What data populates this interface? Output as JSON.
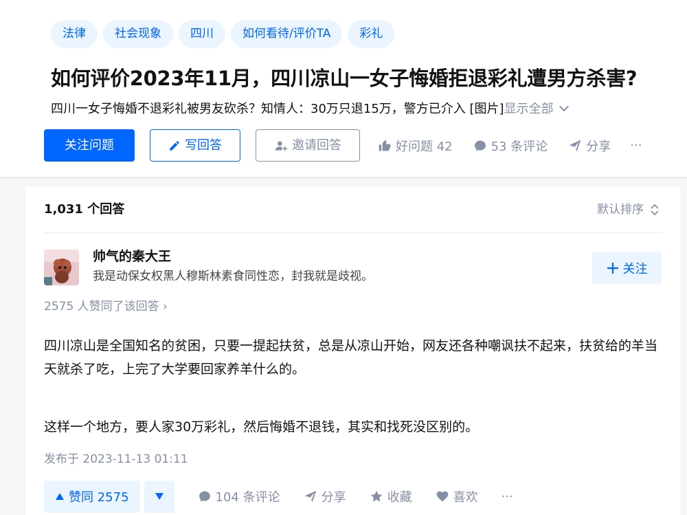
{
  "topics": [
    "法律",
    "社会现象",
    "四川",
    "如何看待/评价TA",
    "彩礼"
  ],
  "question": {
    "title": "如何评价2023年11月，四川凉山一女子悔婚拒退彩礼遭男方杀害?",
    "detail": "四川一女子悔婚不退彩礼被男友砍杀？知情人：30万只退15万，警方已介入 [图片]",
    "show_all": "显示全部"
  },
  "question_actions": {
    "follow": "关注问题",
    "write": "写回答",
    "invite": "邀请回答",
    "good_question": "好问题 42",
    "comments": "53 条评论",
    "share": "分享",
    "more": "···"
  },
  "answers": {
    "count_label": "1,031 个回答",
    "sort_label": "默认排序"
  },
  "answer": {
    "author_name": "帅气的秦大王",
    "author_bio": "我是动保女权黑人穆斯林素食同性恋，封我就是歧视。",
    "follow_label": "关注",
    "voters_label": "2575 人赞同了该回答",
    "paragraph1": "四川凉山是全国知名的贫困，只要一提起扶贫，总是从凉山开始，网友还各种嘲讽扶不起来，扶贫给的羊当天就杀了吃，上完了大学要回家养羊什么的。",
    "paragraph2": "这样一个地方，要人家30万彩礼，然后悔婚不退钱，其实和找死没区别的。",
    "published": "发布于 2023-11-13 01:11",
    "vote_label": "赞同 2575",
    "comments": "104 条评论",
    "share": "分享",
    "collect": "收藏",
    "like": "喜欢",
    "more": "···"
  },
  "colors": {
    "brand_blue": "#0066ff",
    "tag_bg": "#ebf5ff",
    "meta_grey": "#8590a6"
  }
}
